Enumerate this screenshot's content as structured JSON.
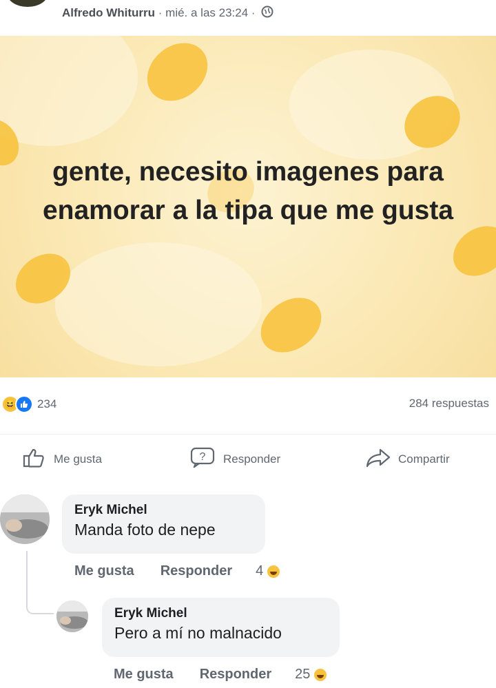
{
  "post": {
    "author": "Alfredo Whiturru",
    "separator1": " · ",
    "time": "mié. a las 23:24",
    "separator2": " · ",
    "privacy_icon": "globe-icon",
    "text": "gente, necesito imagenes para enamorar a la tipa que me gusta"
  },
  "stats": {
    "reaction_icons": [
      "haha-icon",
      "like-icon"
    ],
    "reaction_count": "234",
    "replies": "284 respuestas"
  },
  "actions": {
    "like": "Me gusta",
    "reply": "Responder",
    "share": "Compartir"
  },
  "comments": [
    {
      "name": "Eryk Michel",
      "text": "Manda foto de nepe",
      "like": "Me gusta",
      "reply": "Responder",
      "reactions": "4"
    },
    {
      "name": "Eryk Michel",
      "text": "Pero a mí no malnacido",
      "like": "Me gusta",
      "reply": "Responder",
      "reactions": "25"
    }
  ],
  "colors": {
    "banner": "#fbe9b6",
    "blob": "#f7c33f",
    "meta_text": "#606770",
    "like_blue": "#1877f2"
  }
}
